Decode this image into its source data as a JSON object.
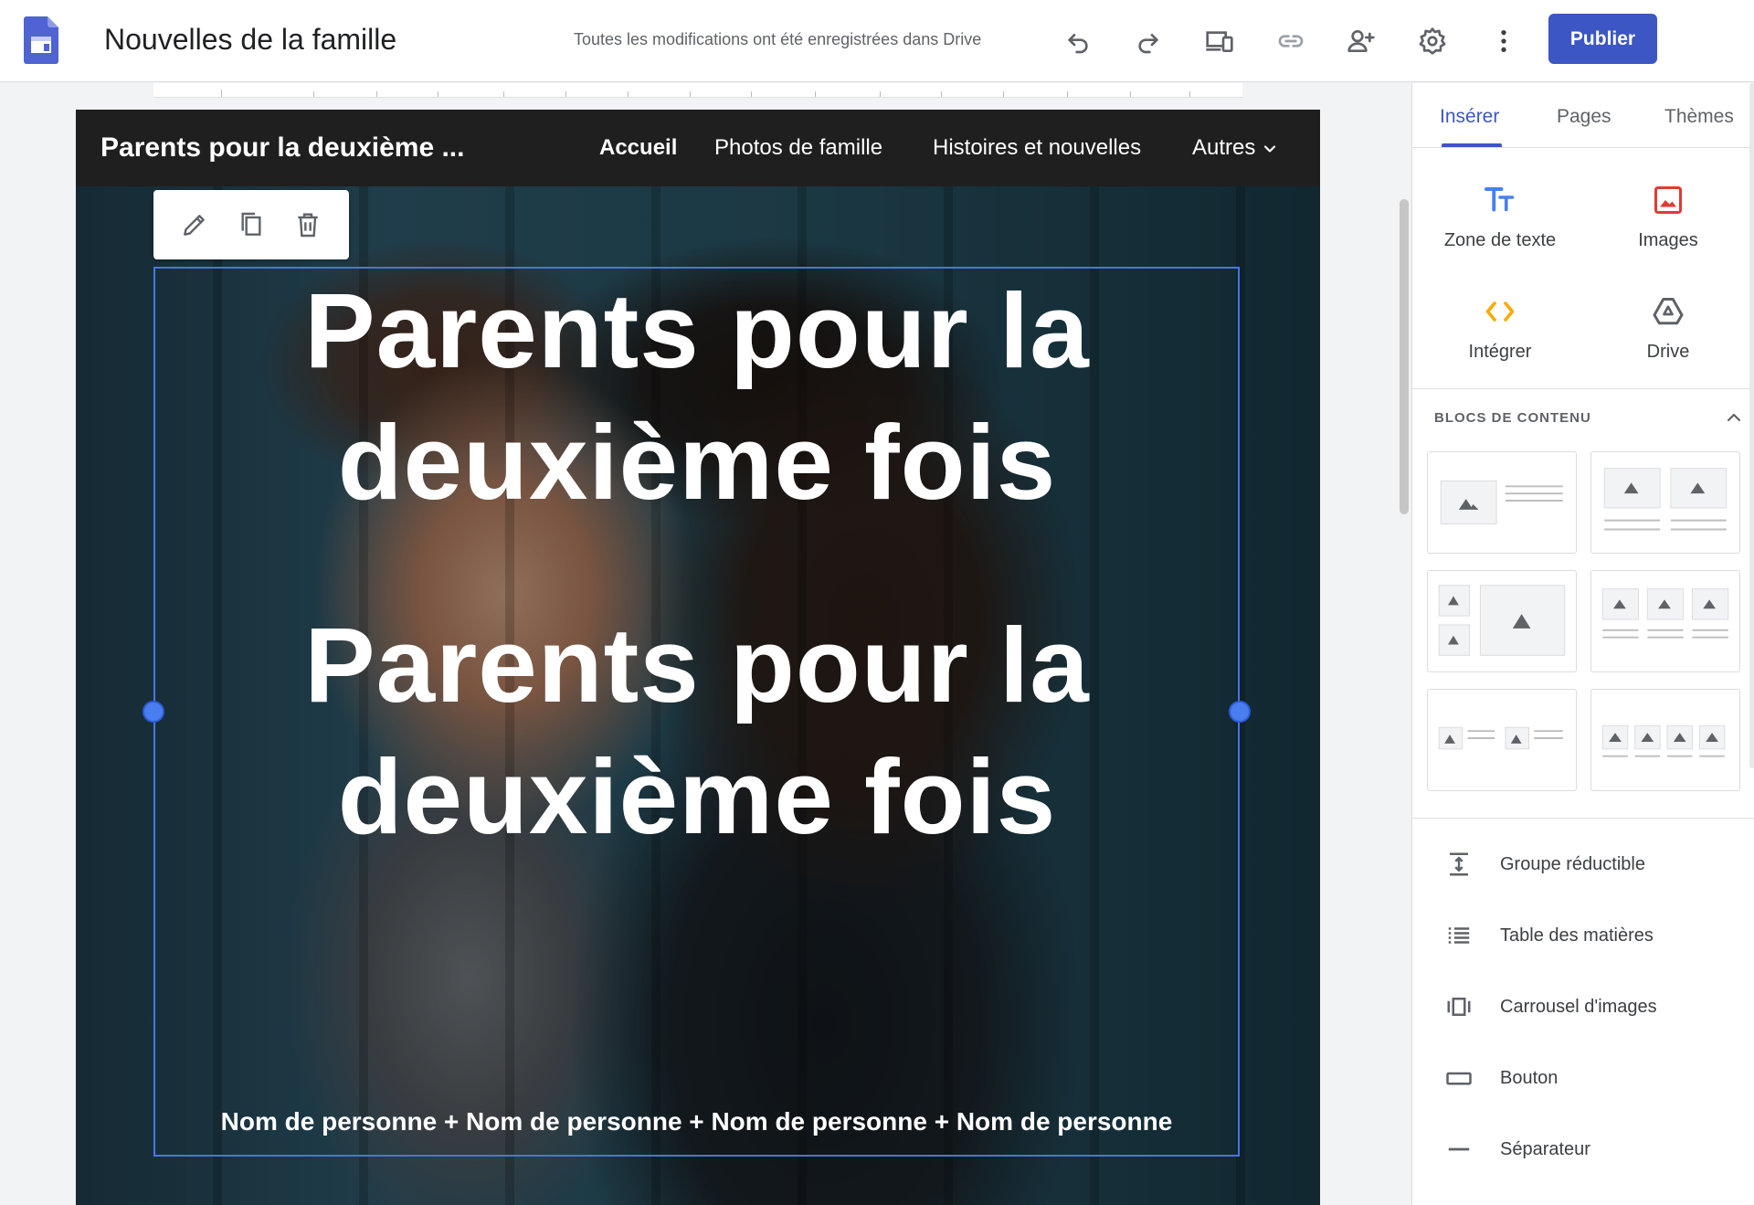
{
  "header": {
    "doc_title": "Nouvelles de la famille",
    "save_status": "Toutes les modifications ont été enregistrées dans Drive",
    "publish_label": "Publier",
    "icons": [
      "undo-icon",
      "redo-icon",
      "preview-devices-icon",
      "link-icon",
      "share-user-icon",
      "settings-icon",
      "more-vert-icon"
    ],
    "accent_color": "#3c57c3"
  },
  "site": {
    "title": "Parents pour la deuxième ...",
    "nav": [
      {
        "label": "Accueil",
        "active": true
      },
      {
        "label": "Photos de famille"
      },
      {
        "label": "Histoires et nouvelles"
      },
      {
        "label": "Autres"
      }
    ],
    "hero": {
      "heading_1_line_1": "Parents pour la",
      "heading_1_line_2": "deuxième fois",
      "heading_2_line_1": "Parents pour la",
      "heading_2_line_2": "deuxième fois",
      "names": "Nom de personne + Nom de personne + Nom de personne + Nom de personne"
    },
    "selection_color": "#4a74e8"
  },
  "panel": {
    "tabs": [
      "Insérer",
      "Pages",
      "Thèmes"
    ],
    "active_tab": "Insérer",
    "insert_items": [
      {
        "label": "Zone de texte",
        "icon": "text-box-icon"
      },
      {
        "label": "Images",
        "icon": "image-icon"
      },
      {
        "label": "Intégrer",
        "icon": "embed-icon"
      },
      {
        "label": "Drive",
        "icon": "drive-icon"
      }
    ],
    "blocks_title": "BLOCS DE CONTENU",
    "list_items": [
      {
        "label": "Groupe réductible",
        "icon": "collapsible-group-icon"
      },
      {
        "label": "Table des matières",
        "icon": "table-of-contents-icon"
      },
      {
        "label": "Carrousel d'images",
        "icon": "image-carousel-icon"
      },
      {
        "label": "Bouton",
        "icon": "button-icon"
      },
      {
        "label": "Séparateur",
        "icon": "divider-icon"
      }
    ]
  }
}
